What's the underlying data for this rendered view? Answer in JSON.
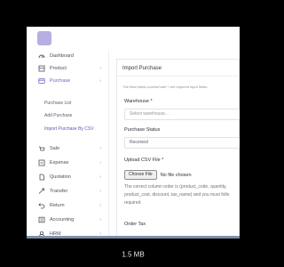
{
  "sidebar": {
    "items": [
      {
        "label": "Dashboard",
        "icon": "dashboard-icon",
        "has_chevron": false
      },
      {
        "label": "Product",
        "icon": "product-icon",
        "has_chevron": true
      },
      {
        "label": "Purchase",
        "icon": "purchase-icon",
        "has_chevron": true,
        "active": true
      },
      {
        "label": "Sale",
        "icon": "sale-icon",
        "has_chevron": true
      },
      {
        "label": "Expense",
        "icon": "expense-icon",
        "has_chevron": true
      },
      {
        "label": "Quotation",
        "icon": "quotation-icon",
        "has_chevron": true
      },
      {
        "label": "Transfer",
        "icon": "transfer-icon",
        "has_chevron": true
      },
      {
        "label": "Return",
        "icon": "return-icon",
        "has_chevron": true
      },
      {
        "label": "Accounting",
        "icon": "accounting-icon",
        "has_chevron": true
      },
      {
        "label": "HRM",
        "icon": "hrm-icon",
        "has_chevron": true
      }
    ],
    "chevron": "‹",
    "purchase_submenu": [
      "Purchase List",
      "Add Purchase",
      "Import Purchase By CSV"
    ]
  },
  "form": {
    "title": "Import Purchase",
    "required_note": "The field labels marked with * are required input fields.",
    "warehouse_label": "Warehouse *",
    "warehouse_placeholder": "Select warehouse...",
    "status_label": "Purchase Status",
    "status_value": "Received",
    "csv_label": "Upload CSV File *",
    "choose_file_label": "Choose File",
    "no_file_text": "No file chosen",
    "help_line1": "The correct column order is (product_code, quantity,",
    "help_line2": "product_cost, discount, tax_name) and you must follo",
    "help_line3": "required",
    "order_tax_label": "Order Tax"
  },
  "viewer": {
    "file_size": "1.5 MB"
  },
  "colors": {
    "accent": "#7c5cc4",
    "logo": "#b8aee3",
    "background": "#000000",
    "bottom_bar": "#7e8fa8"
  }
}
